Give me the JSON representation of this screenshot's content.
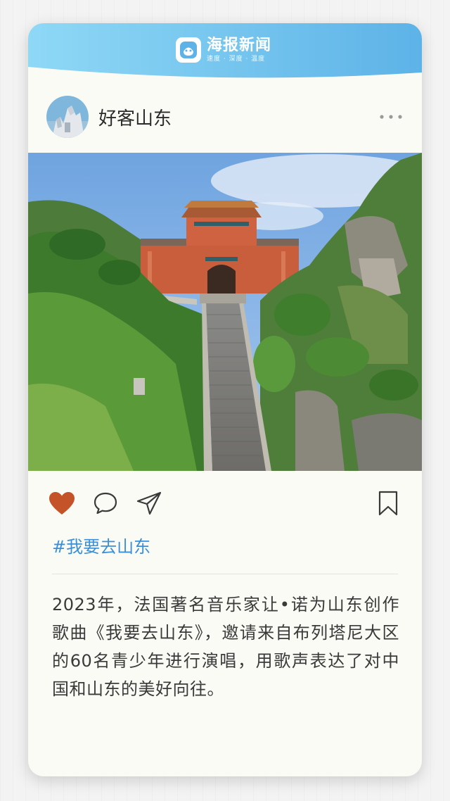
{
  "brand": {
    "name": "海报新闻",
    "slogan": "速度 · 深度 · 温度",
    "logo_icon": "smiley-logo-icon",
    "gradient_start": "#8fd6f5",
    "gradient_end": "#5fb4e8"
  },
  "post": {
    "account_name": "好客山东",
    "more_icon": "more-dots-icon",
    "photo_subject": "mountain-temple-stairs",
    "actions": {
      "like_icon": "heart-icon",
      "like_color": "#c4532a",
      "comment_icon": "comment-bubble-icon",
      "share_icon": "send-icon",
      "bookmark_icon": "bookmark-icon"
    },
    "hashtag": "#我要去山东",
    "hashtag_color": "#3a8fd6",
    "caption": "2023年，法国著名音乐家让•诺为山东创作歌曲《我要去山东》，邀请来自布列塔尼大区的60名青少年进行演唱，用歌声表达了对中国和山东的美好向往。"
  }
}
